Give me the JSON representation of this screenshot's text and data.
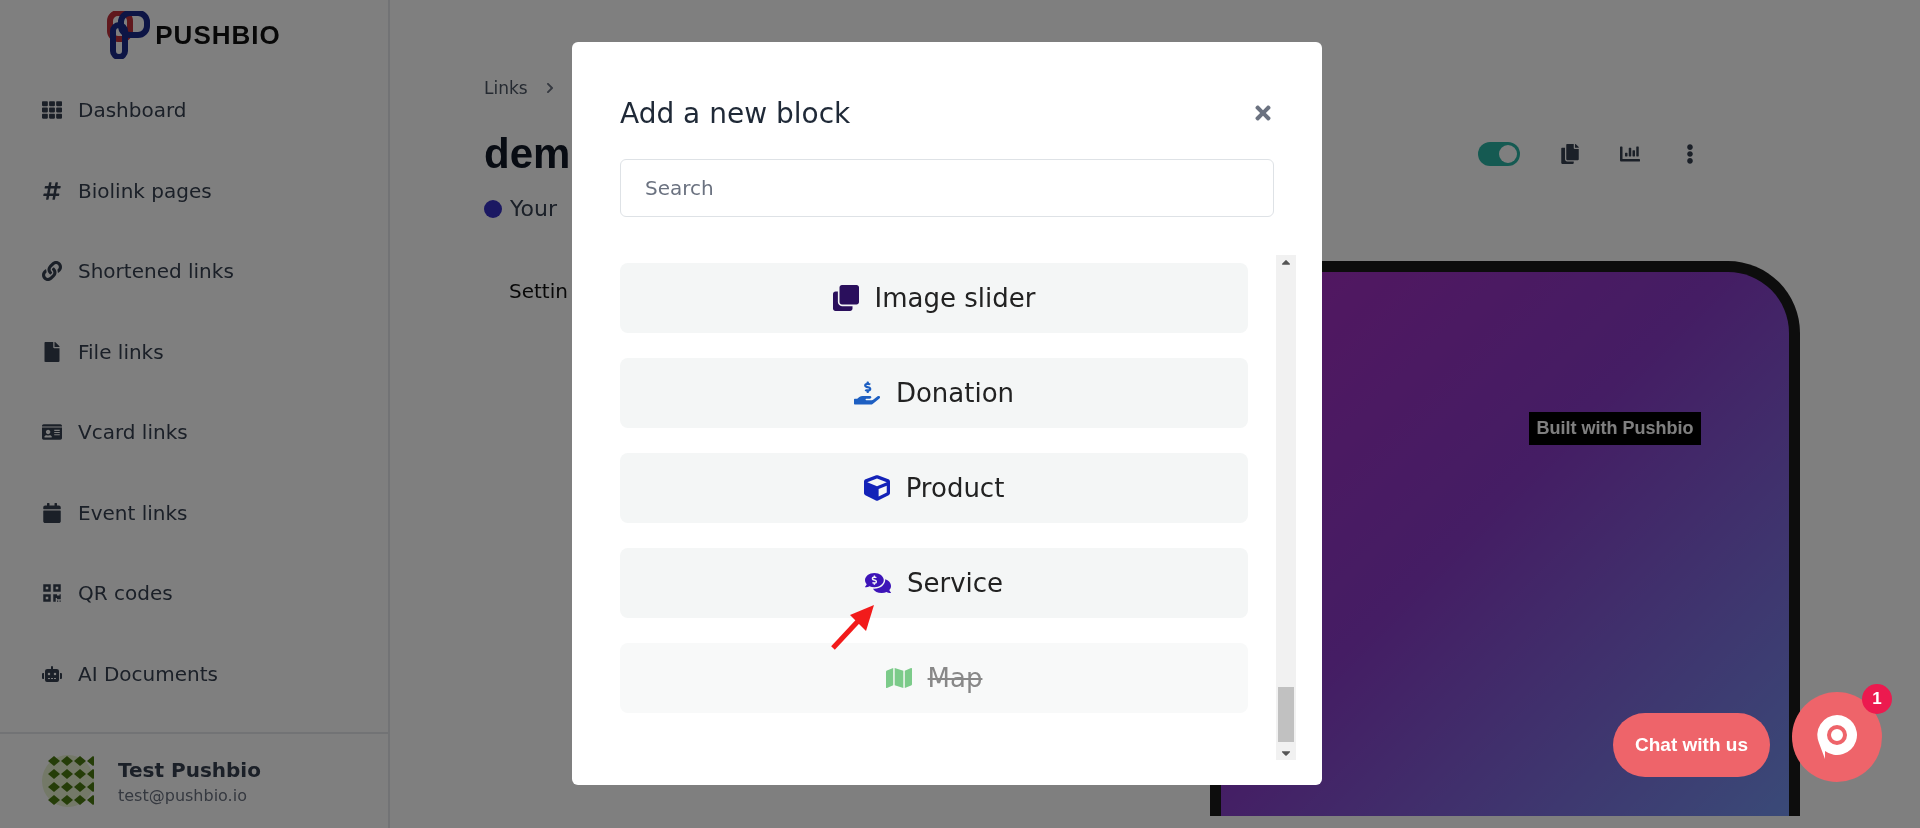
{
  "brand": {
    "name": "PUSHBIO"
  },
  "sidebar": {
    "items": [
      {
        "label": "Dashboard"
      },
      {
        "label": "Biolink pages"
      },
      {
        "label": "Shortened links"
      },
      {
        "label": "File links"
      },
      {
        "label": "Vcard links"
      },
      {
        "label": "Event links"
      },
      {
        "label": "QR codes"
      },
      {
        "label": "AI Documents"
      }
    ],
    "user": {
      "name": "Test Pushbio",
      "email": "test@pushbio.io"
    }
  },
  "page": {
    "breadcrumb": [
      "Links"
    ],
    "title": "dem",
    "status": "Your",
    "tab": "Settin",
    "toggle": {
      "on": true
    }
  },
  "preview": {
    "badge": "Built with Pushbio"
  },
  "modal": {
    "title": "Add a new block",
    "search": {
      "placeholder": "Search"
    },
    "blocks": [
      {
        "label": "Image slider",
        "disabled": false
      },
      {
        "label": "Donation",
        "disabled": false
      },
      {
        "label": "Product",
        "disabled": false
      },
      {
        "label": "Service",
        "disabled": false
      },
      {
        "label": "Map",
        "disabled": true
      }
    ]
  },
  "chat": {
    "label": "Chat with us",
    "count": "1"
  }
}
